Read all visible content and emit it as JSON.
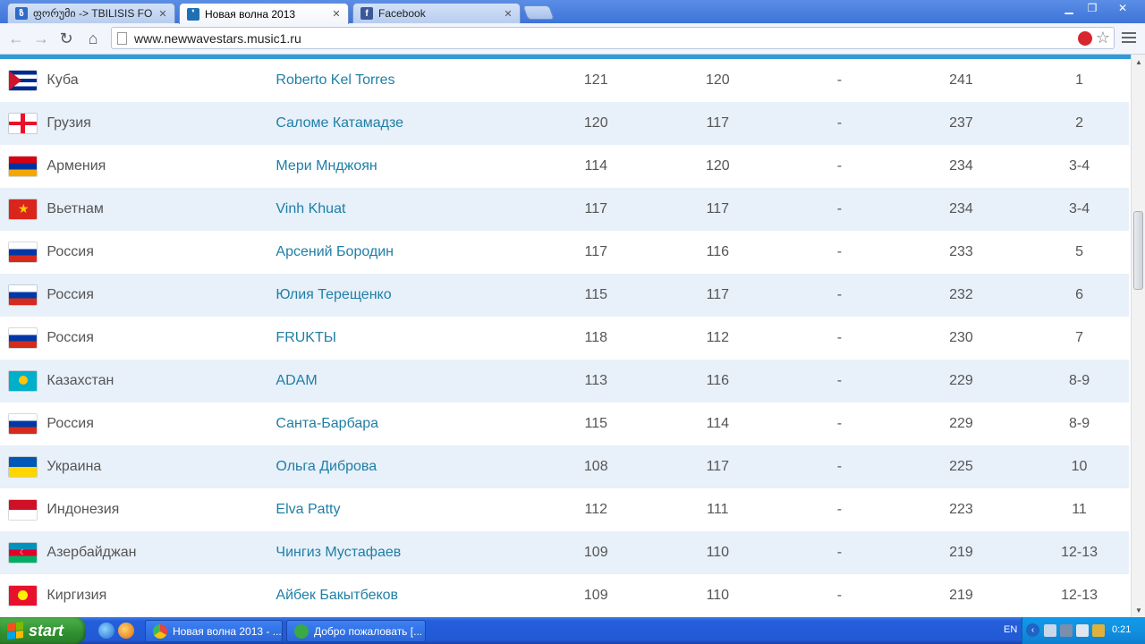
{
  "browser": {
    "tabs": [
      {
        "title": "ფორუმი -> TBILISIS FORUM",
        "active": false,
        "favicon": "forum-favicon",
        "favicon_color": "#2f6ac8",
        "favicon_glyph": "ზ"
      },
      {
        "title": "Новая волна 2013",
        "active": true,
        "favicon": "newwave-favicon",
        "favicon_color": "#1e6fb3",
        "favicon_glyph": "❜"
      },
      {
        "title": "Facebook",
        "active": false,
        "favicon": "facebook-favicon",
        "favicon_color": "#3b5998",
        "favicon_glyph": "f"
      }
    ],
    "url": "www.newwavestars.music1.ru",
    "accent_color": "#2e9bd6"
  },
  "results": {
    "link_color": "#1e7fa6",
    "rows": [
      {
        "country": "Куба",
        "flag": "cuba",
        "artist": "Roberto Kel Torres",
        "j1": "121",
        "j2": "120",
        "j3": "-",
        "total": "241",
        "place": "1"
      },
      {
        "country": "Грузия",
        "flag": "georgia",
        "artist": "Саломе Катамадзе",
        "j1": "120",
        "j2": "117",
        "j3": "-",
        "total": "237",
        "place": "2"
      },
      {
        "country": "Армения",
        "flag": "armenia",
        "artist": "Мери Мнджоян",
        "j1": "114",
        "j2": "120",
        "j3": "-",
        "total": "234",
        "place": "3-4"
      },
      {
        "country": "Вьетнам",
        "flag": "vietnam",
        "artist": "Vinh Khuat",
        "j1": "117",
        "j2": "117",
        "j3": "-",
        "total": "234",
        "place": "3-4"
      },
      {
        "country": "Россия",
        "flag": "russia",
        "artist": "Арсений Бородин",
        "j1": "117",
        "j2": "116",
        "j3": "-",
        "total": "233",
        "place": "5"
      },
      {
        "country": "Россия",
        "flag": "russia",
        "artist": "Юлия Терещенко",
        "j1": "115",
        "j2": "117",
        "j3": "-",
        "total": "232",
        "place": "6"
      },
      {
        "country": "Россия",
        "flag": "russia",
        "artist": "FRUKTЫ",
        "j1": "118",
        "j2": "112",
        "j3": "-",
        "total": "230",
        "place": "7"
      },
      {
        "country": "Казахстан",
        "flag": "kazakhstan",
        "artist": "ADAM",
        "j1": "113",
        "j2": "116",
        "j3": "-",
        "total": "229",
        "place": "8-9"
      },
      {
        "country": "Россия",
        "flag": "russia",
        "artist": "Санта-Барбара",
        "j1": "115",
        "j2": "114",
        "j3": "-",
        "total": "229",
        "place": "8-9"
      },
      {
        "country": "Украина",
        "flag": "ukraine",
        "artist": "Ольга Диброва",
        "j1": "108",
        "j2": "117",
        "j3": "-",
        "total": "225",
        "place": "10"
      },
      {
        "country": "Индонезия",
        "flag": "indonesia",
        "artist": "Elva Patty",
        "j1": "112",
        "j2": "111",
        "j3": "-",
        "total": "223",
        "place": "11"
      },
      {
        "country": "Азербайджан",
        "flag": "azerbaijan",
        "artist": "Чингиз Мустафаев",
        "j1": "109",
        "j2": "110",
        "j3": "-",
        "total": "219",
        "place": "12-13"
      },
      {
        "country": "Киргизия",
        "flag": "kyrgyzstan",
        "artist": "Айбек Бакытбеков",
        "j1": "109",
        "j2": "110",
        "j3": "-",
        "total": "219",
        "place": "12-13"
      }
    ]
  },
  "taskbar": {
    "start_label": "start",
    "tasks": [
      {
        "label": "Новая волна 2013 - ...",
        "icon": "chrome-icon",
        "icon_color": "#e8453c"
      },
      {
        "label": "Добро пожаловать [...",
        "icon": "messenger-icon",
        "icon_color": "#3aa845"
      }
    ],
    "language": "EN",
    "clock": "0:21"
  }
}
